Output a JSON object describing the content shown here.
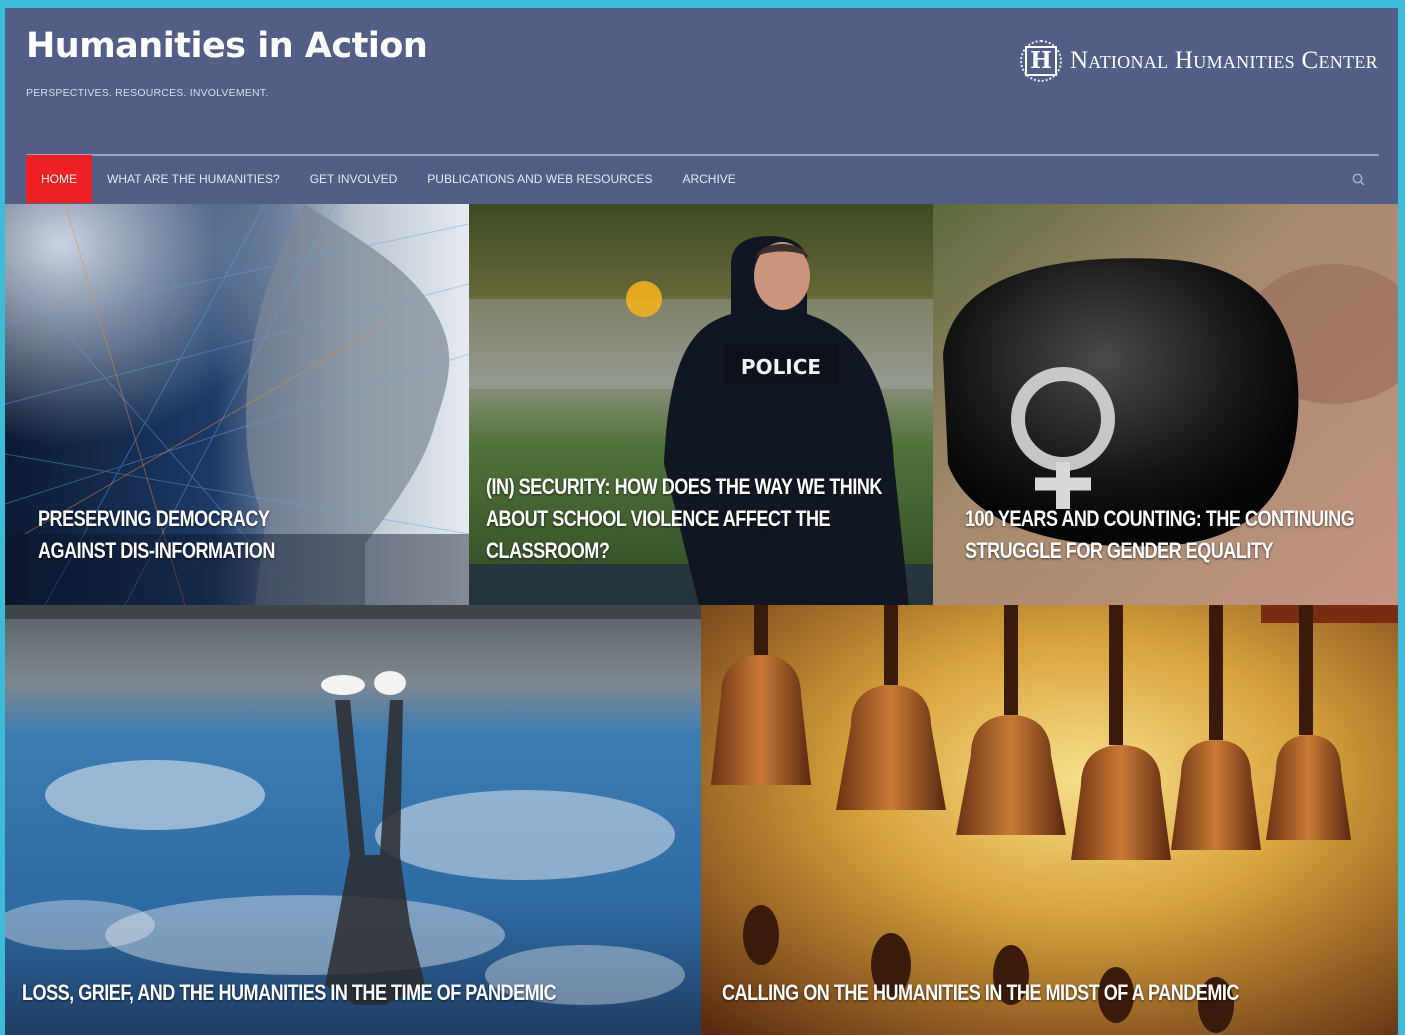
{
  "site": {
    "title": "Humanities in Action",
    "tagline": "PERSPECTIVES. RESOURCES. INVOLVEMENT.",
    "logo_letter": "H",
    "logo_text": "National Humanities Center"
  },
  "nav": {
    "items": [
      {
        "label": "HOME",
        "active": true
      },
      {
        "label": "WHAT ARE THE HUMANITIES?",
        "active": false
      },
      {
        "label": "GET INVOLVED",
        "active": false
      },
      {
        "label": "PUBLICATIONS AND WEB RESOURCES",
        "active": false
      },
      {
        "label": "ARCHIVE",
        "active": false
      }
    ],
    "search_icon": "search-icon"
  },
  "colors": {
    "page_border": "#3dbcd8",
    "header_bg": "#535e86",
    "nav_active": "#ee2024"
  },
  "tiles": [
    {
      "title_line1": "Preserving Democracy",
      "title_line2": "Against Dis-information"
    },
    {
      "title_line1": "(In) Security: How Does the Way We Think",
      "title_line2": "About School Violence Affect the Classroom?",
      "badge": "POLICE"
    },
    {
      "title_line1": "100 Years and Counting: The Continuing",
      "title_line2": "Struggle for Gender Equality"
    },
    {
      "title_line1": "Loss, Grief, and the Humanities in the Time of Pandemic"
    },
    {
      "title_line1": "Calling on the Humanities in the Midst of a Pandemic"
    }
  ]
}
